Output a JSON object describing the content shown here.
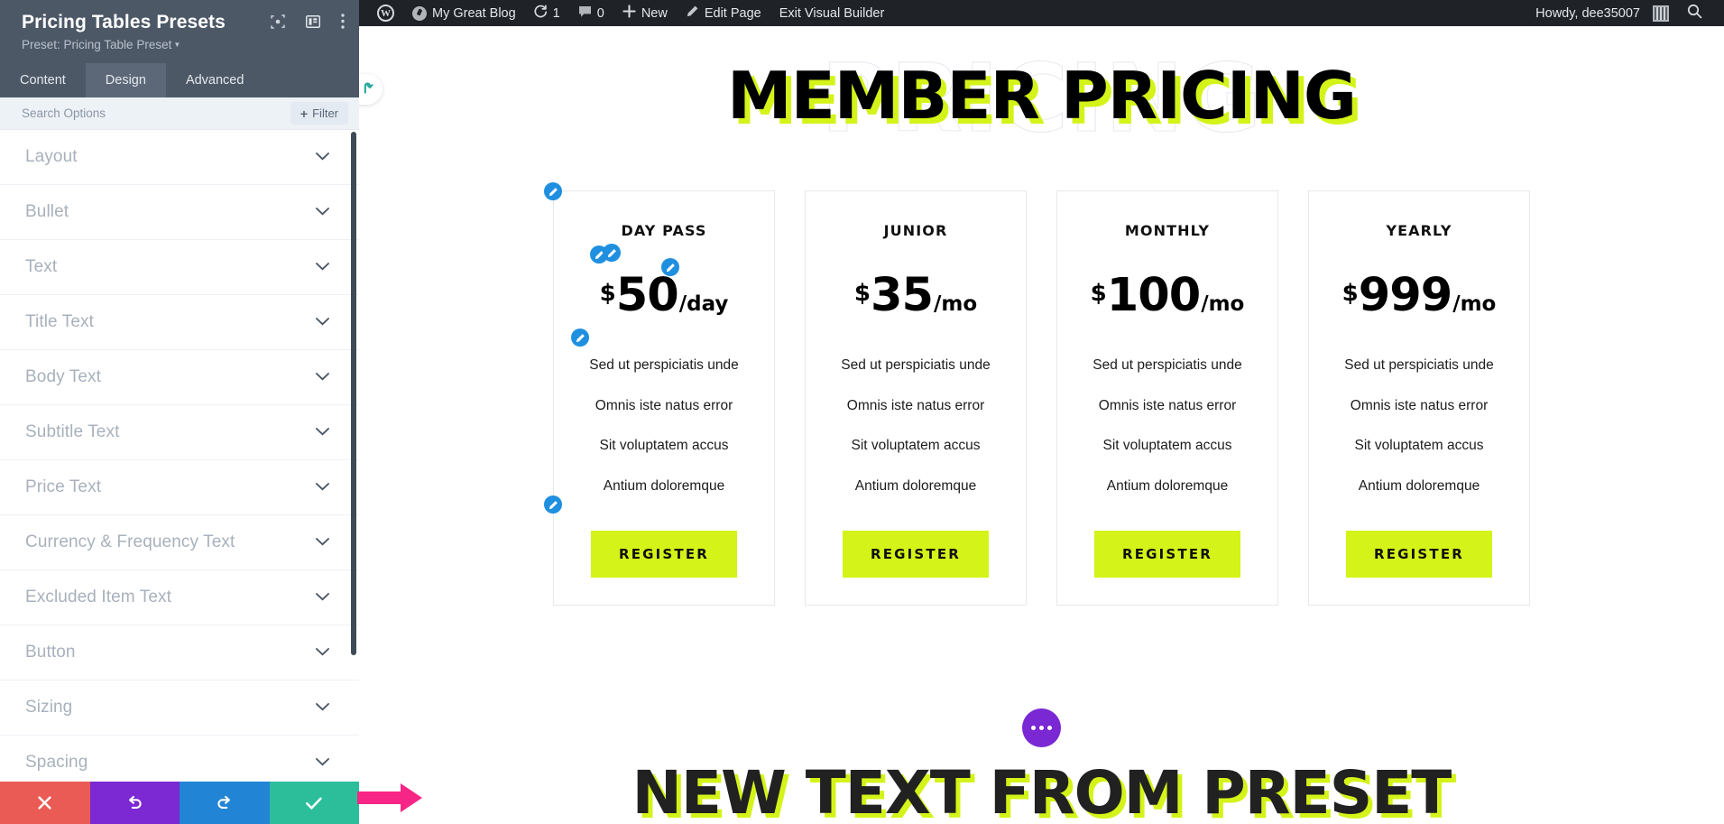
{
  "panel": {
    "title": "Pricing Tables Presets",
    "preset_label": "Preset: Pricing Table Preset",
    "icons": {
      "focus": "focus-target-icon",
      "layout": "panel-layout-icon",
      "more": "more-vertical-icon"
    },
    "tabs": [
      {
        "label": "Content",
        "active": false
      },
      {
        "label": "Design",
        "active": true
      },
      {
        "label": "Advanced",
        "active": false
      }
    ],
    "search": {
      "placeholder": "Search Options",
      "value": "",
      "filter_label": "Filter"
    },
    "options": [
      {
        "label": "Layout"
      },
      {
        "label": "Bullet"
      },
      {
        "label": "Text"
      },
      {
        "label": "Title Text"
      },
      {
        "label": "Body Text"
      },
      {
        "label": "Subtitle Text"
      },
      {
        "label": "Price Text"
      },
      {
        "label": "Currency & Frequency Text"
      },
      {
        "label": "Excluded Item Text"
      },
      {
        "label": "Button"
      },
      {
        "label": "Sizing"
      },
      {
        "label": "Spacing"
      }
    ],
    "bottom_actions": [
      {
        "name": "discard-button",
        "icon": "close-icon",
        "color": "#eb5b56"
      },
      {
        "name": "undo-button",
        "icon": "undo-icon",
        "color": "#7c28d3"
      },
      {
        "name": "redo-button",
        "icon": "redo-icon",
        "color": "#2284d4"
      },
      {
        "name": "save-button",
        "icon": "check-icon",
        "color": "#2cbe9b"
      }
    ],
    "pointer_arrow_color": "#f72585"
  },
  "adminbar": {
    "wp_logo": "wordpress-icon",
    "site_name": "My Great Blog",
    "updates_icon": "updates-icon",
    "updates_count": "1",
    "comments_icon": "comment-icon",
    "comments_count": "0",
    "new_icon": "plus-icon",
    "new_label": "New",
    "edit_icon": "pencil-icon",
    "edit_label": "Edit Page",
    "exit_label": "Exit Visual Builder",
    "howdy": "Howdy, dee35007",
    "avatar": "avatar",
    "search_icon": "search-icon"
  },
  "canvas": {
    "back_icon": "back-arrow-icon",
    "hero": {
      "watermark": "PRICING",
      "title": "MEMBER PRICING"
    },
    "cards": [
      {
        "title": "DAY PASS",
        "currency": "$",
        "amount": "50",
        "frequency": "/day",
        "features": [
          "Sed ut perspiciatis unde",
          "Omnis iste natus error",
          "Sit voluptatem accus",
          "Antium doloremque"
        ],
        "button": "REGISTER"
      },
      {
        "title": "JUNIOR",
        "currency": "$",
        "amount": "35",
        "frequency": "/mo",
        "features": [
          "Sed ut perspiciatis unde",
          "Omnis iste natus error",
          "Sit voluptatem accus",
          "Antium doloremque"
        ],
        "button": "REGISTER"
      },
      {
        "title": "MONTHLY",
        "currency": "$",
        "amount": "100",
        "frequency": "/mo",
        "features": [
          "Sed ut perspiciatis unde",
          "Omnis iste natus error",
          "Sit voluptatem accus",
          "Antium doloremque"
        ],
        "button": "REGISTER"
      },
      {
        "title": "YEARLY",
        "currency": "$",
        "amount": "999",
        "frequency": "/mo",
        "features": [
          "Sed ut perspiciatis unde",
          "Omnis iste natus error",
          "Sit voluptatem accus",
          "Antium doloremque"
        ],
        "button": "REGISTER"
      }
    ],
    "bottom": {
      "dots_icon": "more-horizontal-icon",
      "title": "NEW TEXT FROM PRESET"
    }
  },
  "colors": {
    "accent_yellow": "#d4f318",
    "panel_header": "#4c5866",
    "edit_badge": "#1f8fe0",
    "purple": "#7a27d4"
  }
}
